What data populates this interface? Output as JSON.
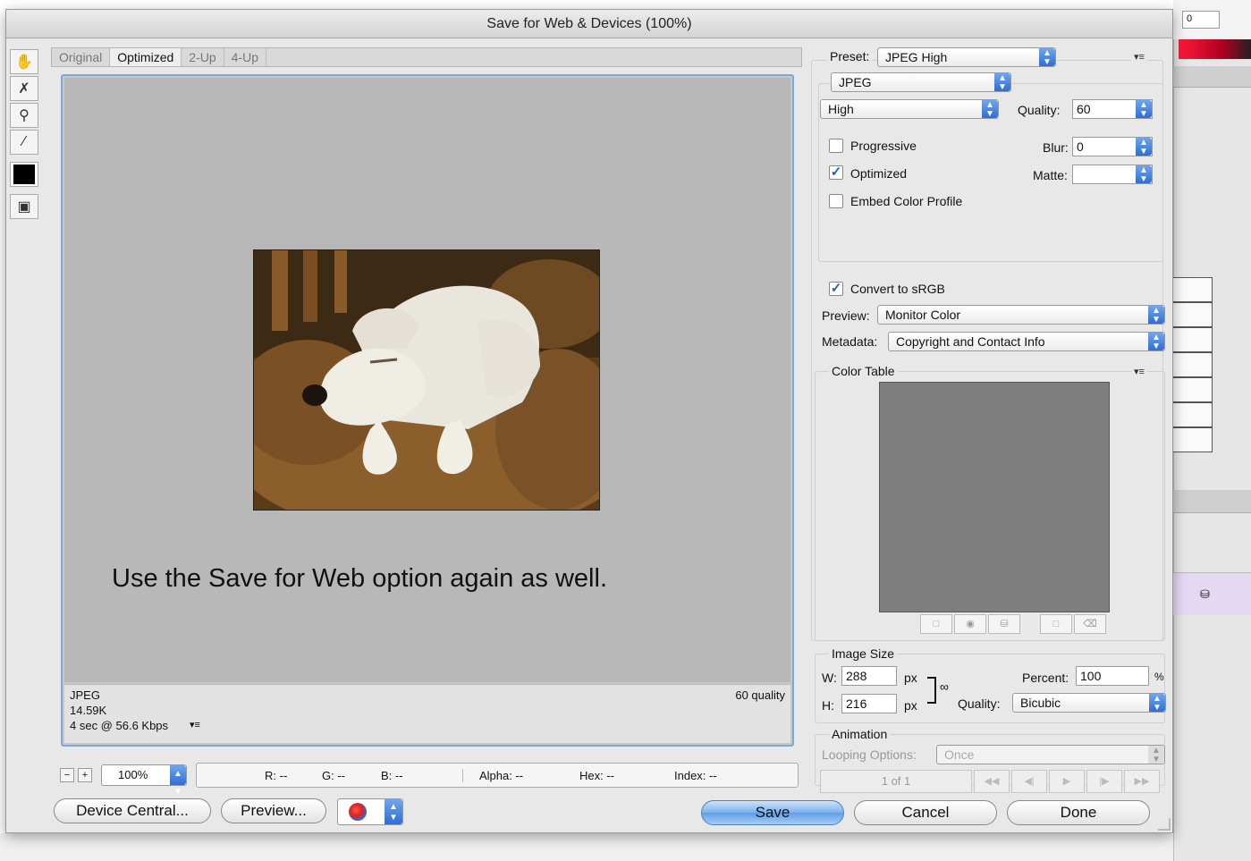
{
  "dialog": {
    "title": "Save for Web & Devices (100%)"
  },
  "background": {
    "field_value": "0"
  },
  "tabs": [
    "Original",
    "Optimized",
    "2-Up",
    "4-Up"
  ],
  "preview": {
    "caption": "Use the Save for Web option again as well.",
    "info_format": "JPEG",
    "info_size": "14.59K",
    "info_time": "4 sec @ 56.6 Kbps",
    "info_quality": "60 quality"
  },
  "statusbar": {
    "zoom": "100%",
    "r": "R: --",
    "g": "G: --",
    "b": "B: --",
    "alpha": "Alpha: --",
    "hex": "Hex: --",
    "index": "Index: --"
  },
  "buttons": {
    "device_central": "Device Central...",
    "preview": "Preview...",
    "save": "Save",
    "cancel": "Cancel",
    "done": "Done"
  },
  "settings": {
    "preset_label": "Preset:",
    "preset_value": "JPEG High",
    "format_value": "JPEG",
    "compression_value": "High",
    "quality_label": "Quality:",
    "quality_value": "60",
    "progressive_label": "Progressive",
    "progressive_checked": false,
    "blur_label": "Blur:",
    "blur_value": "0",
    "optimized_label": "Optimized",
    "optimized_checked": true,
    "matte_label": "Matte:",
    "matte_value": "",
    "embed_label": "Embed Color Profile",
    "embed_checked": false,
    "convert_label": "Convert to sRGB",
    "convert_checked": true,
    "preview_label": "Preview:",
    "preview_value": "Monitor Color",
    "metadata_label": "Metadata:",
    "metadata_value": "Copyright and Contact Info",
    "color_table_label": "Color Table",
    "image_size_label": "Image Size",
    "w_label": "W:",
    "w_value": "288",
    "h_label": "H:",
    "h_value": "216",
    "px": "px",
    "percent_label": "Percent:",
    "percent_value": "100",
    "percent_unit": "%",
    "resample_label": "Quality:",
    "resample_value": "Bicubic",
    "animation_label": "Animation",
    "looping_label": "Looping Options:",
    "looping_value": "Once",
    "frame_counter": "1 of 1"
  }
}
